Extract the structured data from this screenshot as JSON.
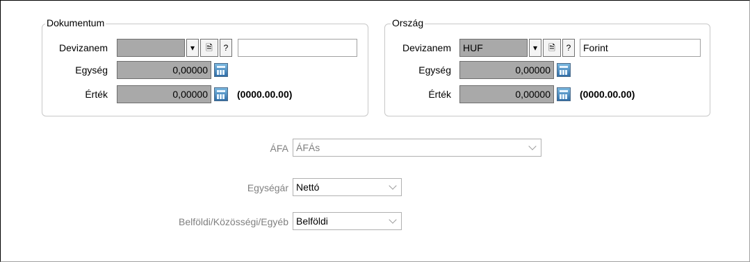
{
  "dokumentum": {
    "title": "Dokumentum",
    "devizanem_label": "Devizanem",
    "devizanem_value": "",
    "dropdown_glyph": "▾",
    "doc_glyph": "🗎",
    "help_glyph": "?",
    "currency_name": "",
    "egyseg_label": "Egység",
    "egyseg_value": "0,00000",
    "ertek_label": "Érték",
    "ertek_value": "0,00000",
    "date_text": "(0000.00.00)"
  },
  "orszag": {
    "title": "Ország",
    "devizanem_label": "Devizanem",
    "devizanem_value": "HUF",
    "dropdown_glyph": "▾",
    "doc_glyph": "🗎",
    "help_glyph": "?",
    "currency_name": "Forint",
    "egyseg_label": "Egység",
    "egyseg_value": "0,00000",
    "ertek_label": "Érték",
    "ertek_value": "0,00000",
    "date_text": "(0000.00.00)"
  },
  "afa": {
    "label": "ÁFA",
    "value": "ÁFÁs"
  },
  "egysegar": {
    "label": "Egységár",
    "value": "Nettó"
  },
  "belfoldi": {
    "label": "Belföldi/Közösségi/Egyéb",
    "value": "Belföldi"
  }
}
